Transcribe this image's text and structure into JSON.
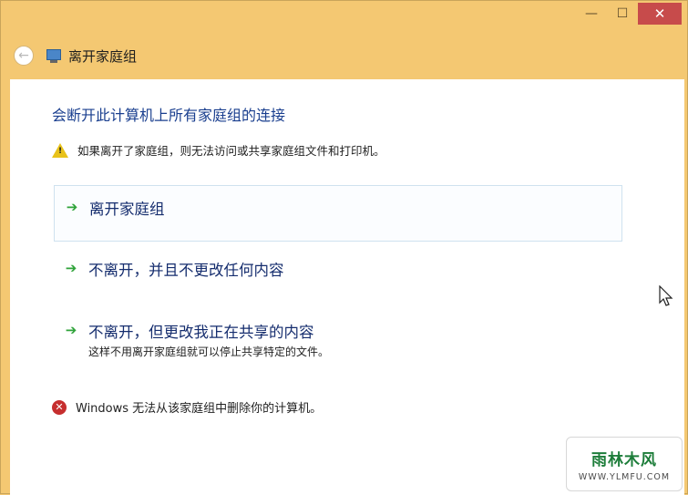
{
  "window": {
    "title": "离开家庭组",
    "controls": {
      "minimize": "—",
      "maximize": "☐",
      "close": "✕"
    }
  },
  "header": {
    "back_icon": "back-arrow-icon",
    "app_icon": "homegroup-icon"
  },
  "content": {
    "heading": "会断开此计算机上所有家庭组的连接",
    "warning": {
      "icon": "warning-icon",
      "text": "如果离开了家庭组，则无法访问或共享家庭组文件和打印机。"
    },
    "options": [
      {
        "label": "离开家庭组",
        "desc": ""
      },
      {
        "label": "不离开，并且不更改任何内容",
        "desc": ""
      },
      {
        "label": "不离开，但更改我正在共享的内容",
        "desc": "这样不用离开家庭组就可以停止共享特定的文件。"
      }
    ],
    "error": {
      "icon": "error-icon",
      "text": "Windows 无法从该家庭组中删除你的计算机。"
    }
  },
  "watermark": {
    "main": "雨林木风",
    "sub": "WWW.YLMFU.COM"
  },
  "colors": {
    "frame": "#f4c872",
    "heading": "#1a3f8f",
    "link": "#152d6e",
    "arrow": "#2fa33a",
    "close": "#c74b4b"
  }
}
